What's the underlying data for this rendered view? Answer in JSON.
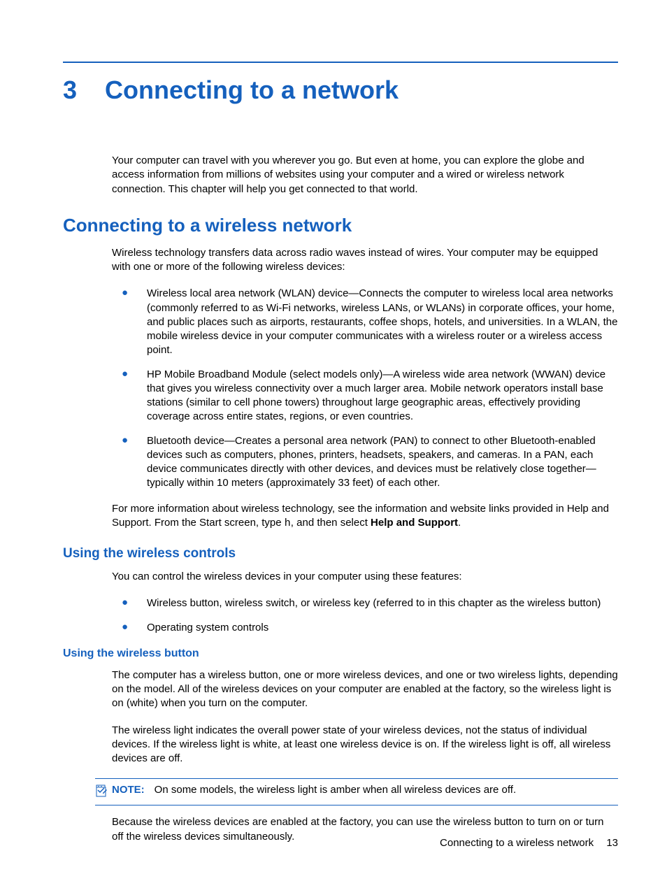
{
  "chapter": {
    "number": "3",
    "title": "Connecting to a network"
  },
  "intro": "Your computer can travel with you wherever you go. But even at home, you can explore the globe and access information from millions of websites using your computer and a wired or wireless network connection. This chapter will help you get connected to that world.",
  "section1": {
    "title": "Connecting to a wireless network",
    "p1": "Wireless technology transfers data across radio waves instead of wires. Your computer may be equipped with one or more of the following wireless devices:",
    "bullets": [
      "Wireless local area network (WLAN) device—Connects the computer to wireless local area networks (commonly referred to as Wi-Fi networks, wireless LANs, or WLANs) in corporate offices, your home, and public places such as airports, restaurants, coffee shops, hotels, and universities. In a WLAN, the mobile wireless device in your computer communicates with a wireless router or a wireless access point.",
      "HP Mobile Broadband Module (select models only)—A wireless wide area network (WWAN) device that gives you wireless connectivity over a much larger area. Mobile network operators install base stations (similar to cell phone towers) throughout large geographic areas, effectively providing coverage across entire states, regions, or even countries.",
      "Bluetooth device—Creates a personal area network (PAN) to connect to other Bluetooth-enabled devices such as computers, phones, printers, headsets, speakers, and cameras. In a PAN, each device communicates directly with other devices, and devices must be relatively close together—typically within 10 meters (approximately 33 feet) of each other."
    ],
    "p2_prefix": "For more information about wireless technology, see the information and website links provided in Help and Support. From the Start screen, type ",
    "p2_mono": "h",
    "p2_mid": ", and then select ",
    "p2_bold": "Help and Support",
    "p2_suffix": "."
  },
  "section2": {
    "title": "Using the wireless controls",
    "p1": "You can control the wireless devices in your computer using these features:",
    "bullets": [
      "Wireless button, wireless switch, or wireless key (referred to in this chapter as the wireless button)",
      "Operating system controls"
    ]
  },
  "section3": {
    "title": "Using the wireless button",
    "p1": "The computer has a wireless button, one or more wireless devices, and one or two wireless lights, depending on the model. All of the wireless devices on your computer are enabled at the factory, so the wireless light is on (white) when you turn on the computer.",
    "p2": "The wireless light indicates the overall power state of your wireless devices, not the status of individual devices. If the wireless light is white, at least one wireless device is on. If the wireless light is off, all wireless devices are off.",
    "note_label": "NOTE:",
    "note_text": "On some models, the wireless light is amber when all wireless devices are off.",
    "p3": "Because the wireless devices are enabled at the factory, you can use the wireless button to turn on or turn off the wireless devices simultaneously."
  },
  "footer": {
    "text": "Connecting to a wireless network",
    "page": "13"
  }
}
